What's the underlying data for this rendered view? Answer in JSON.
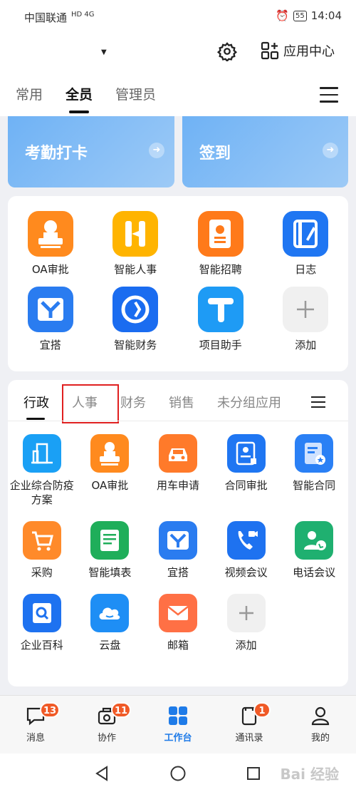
{
  "status_bar": {
    "carrier": "中国联通",
    "network": "HD 4G",
    "battery": "55",
    "time": "14:04"
  },
  "header": {
    "app_center_label": "应用中心",
    "tabs": [
      "常用",
      "全员",
      "管理员"
    ],
    "active_tab": "全员"
  },
  "quick_cards": [
    {
      "label": "考勤打卡"
    },
    {
      "label": "签到"
    }
  ],
  "featured_apps": [
    {
      "label": "OA审批",
      "icon": "stamp-icon",
      "color": "#ff8a1e"
    },
    {
      "label": "智能人事",
      "icon": "h-letter-icon",
      "color": "#ffb400"
    },
    {
      "label": "智能招聘",
      "icon": "resume-icon",
      "color": "#ff7a1a"
    },
    {
      "label": "日志",
      "icon": "notebook-icon",
      "color": "#1f76f2"
    },
    {
      "label": "宜搭",
      "icon": "yida-icon",
      "color": "#2a7cf0"
    },
    {
      "label": "智能财务",
      "icon": "finance-icon",
      "color": "#1a6cf0"
    },
    {
      "label": "项目助手",
      "icon": "t-letter-icon",
      "color": "#1e9bf5"
    },
    {
      "label": "添加",
      "icon": "plus-icon",
      "color": "#f0f0f0"
    }
  ],
  "category_tabs": [
    "行政",
    "人事",
    "财务",
    "销售",
    "未分组应用"
  ],
  "active_category": "行政",
  "category_apps": [
    {
      "label": "企业综合防疫方案",
      "icon": "building-icon",
      "color": "#1aa0f5"
    },
    {
      "label": "OA审批",
      "icon": "stamp-icon",
      "color": "#ff8a1e"
    },
    {
      "label": "用车申请",
      "icon": "car-icon",
      "color": "#ff7a2a"
    },
    {
      "label": "合同审批",
      "icon": "contract-icon",
      "color": "#1f76f2"
    },
    {
      "label": "智能合同",
      "icon": "smart-contract-icon",
      "color": "#2a80f5"
    },
    {
      "label": "采购",
      "icon": "cart-icon",
      "color": "#ff8a2a"
    },
    {
      "label": "智能填表",
      "icon": "form-icon",
      "color": "#1fae5a"
    },
    {
      "label": "宜搭",
      "icon": "yida-icon",
      "color": "#2a7cf0"
    },
    {
      "label": "视频会议",
      "icon": "video-call-icon",
      "color": "#1e72f0"
    },
    {
      "label": "电话会议",
      "icon": "phone-meeting-icon",
      "color": "#1fb070"
    },
    {
      "label": "企业百科",
      "icon": "search-book-icon",
      "color": "#1e72f0"
    },
    {
      "label": "云盘",
      "icon": "cloud-icon",
      "color": "#1e8ef5"
    },
    {
      "label": "邮箱",
      "icon": "mail-icon",
      "color": "#ff7045"
    },
    {
      "label": "添加",
      "icon": "plus-icon",
      "color": "#f0f0f0"
    }
  ],
  "bottom_nav": [
    {
      "label": "消息",
      "icon": "message-icon",
      "badge": "13"
    },
    {
      "label": "协作",
      "icon": "collab-icon",
      "badge": "11"
    },
    {
      "label": "工作台",
      "icon": "workbench-icon",
      "badge": ""
    },
    {
      "label": "通讯录",
      "icon": "contacts-icon",
      "badge": "1"
    },
    {
      "label": "我的",
      "icon": "profile-icon",
      "badge": ""
    }
  ],
  "watermark": "Bai 经验"
}
